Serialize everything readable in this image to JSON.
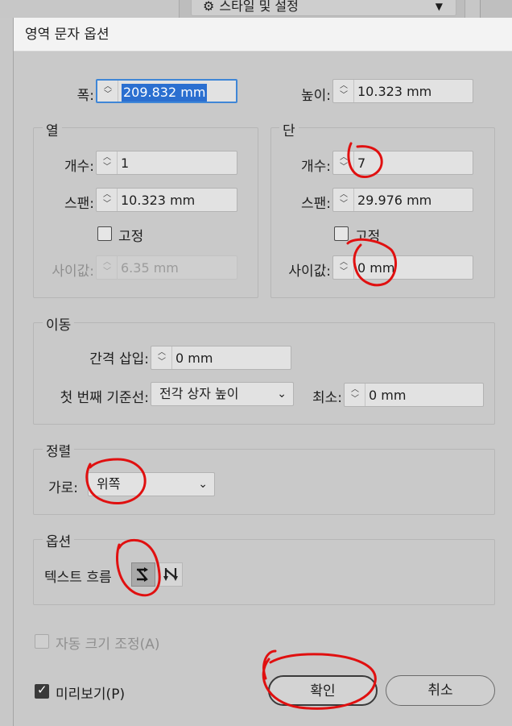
{
  "topbar": {
    "style_label": "스타일 및 설정"
  },
  "dialog": {
    "title": "영역 문자 옵션",
    "width": {
      "label": "폭:",
      "value": "209.832 mm"
    },
    "height": {
      "label": "높이:",
      "value": "10.323 mm"
    },
    "rows": {
      "title": "열",
      "count_label": "개수:",
      "count_value": "1",
      "span_label": "스팬:",
      "span_value": "10.323 mm",
      "fixed_label": "고정",
      "gutter_label": "사이값:",
      "gutter_value": "6.35 mm"
    },
    "columns": {
      "title": "단",
      "count_label": "개수:",
      "count_value": "7",
      "span_label": "스팬:",
      "span_value": "29.976 mm",
      "fixed_label": "고정",
      "gutter_label": "사이값:",
      "gutter_value": "0 mm"
    },
    "offset": {
      "title": "이동",
      "inset_label": "간격 삽입:",
      "inset_value": "0 mm",
      "baseline_label": "첫 번째 기준선:",
      "baseline_value": "전각 상자 높이",
      "min_label": "최소:",
      "min_value": "0 mm"
    },
    "align": {
      "title": "정렬",
      "horizontal_label": "가로:",
      "horizontal_value": "위쪽"
    },
    "options": {
      "title": "옵션",
      "flow_label": "텍스트 흐름"
    },
    "auto_size_label": "자동 크기 조정(A)",
    "preview_label": "미리보기(P)",
    "ok_label": "확인",
    "cancel_label": "취소"
  },
  "colors": {
    "annotation": "#e01010",
    "selection": "#2b6fd0",
    "focus": "#3f86d6"
  }
}
